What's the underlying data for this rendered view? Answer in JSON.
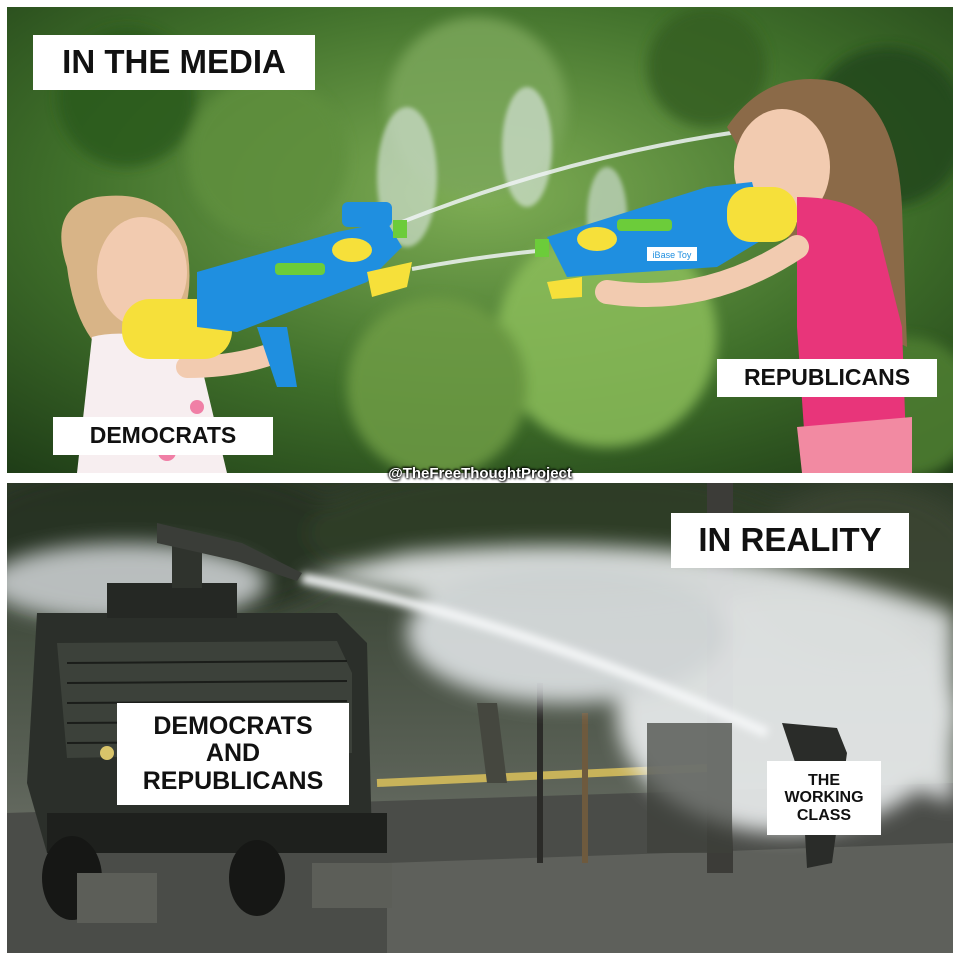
{
  "top_panel": {
    "caption": "IN THE MEDIA",
    "left_label": "DEMOCRATS",
    "right_label": "REPUBLICANS",
    "toy_brand": "iBase Toy"
  },
  "watermark": "@TheFreeThoughtProject",
  "bottom_panel": {
    "caption": "IN REALITY",
    "truck_label": "DEMOCRATS\nAND\nREPUBLICANS",
    "target_label": "THE\nWORKING\nCLASS"
  },
  "colors": {
    "foliage": "#3f6f2a",
    "gun_blue": "#1f8fe0",
    "gun_yellow": "#f6e03a",
    "shirt_pink": "#e8357a",
    "truck": "#2b2f2a",
    "spray": "#e6e9ea"
  }
}
